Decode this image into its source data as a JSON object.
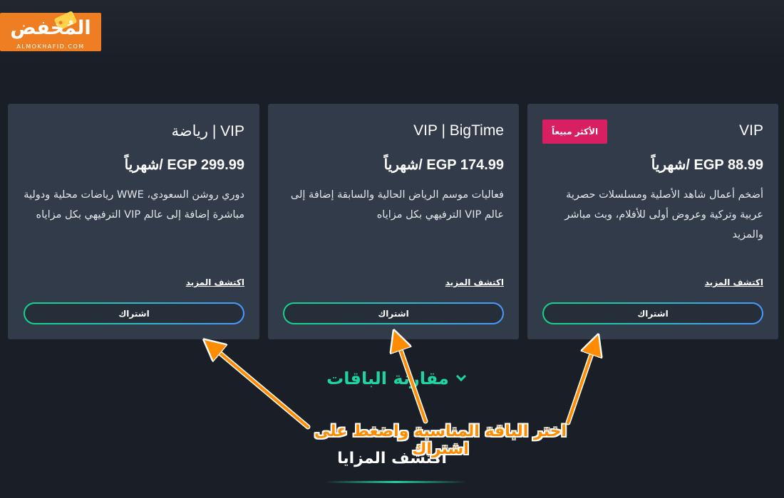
{
  "logo": {
    "text": "المُخفض",
    "subtext": "ALMOKHAFID.COM"
  },
  "plans": [
    {
      "title": "VIP",
      "badge": "الأكثر مبيعاً",
      "price": "EGP 88.99 /شهرياً",
      "description": "أضخم أعمال شاهد الأصلية ومسلسلات حصرية عربية وتركية وعروض أولى للأفلام، وبث مباشر والمزيد",
      "discover_label": "اكتشف المزيد",
      "subscribe_label": "اشتراك"
    },
    {
      "title": "VIP | BigTime",
      "price": "EGP 174.99 /شهرياً",
      "description": "فعاليات موسم الرياض الحالية والسابقة إضافة إلى عالم VIP الترفيهي بكل مزاياه",
      "discover_label": "اكتشف المزيد",
      "subscribe_label": "اشتراك"
    },
    {
      "title": "VIP | رياضة",
      "price": "EGP 299.99 /شهرياً",
      "description": "دوري روشن السعودي، WWE رياضات محلية ودولية مباشرة إضافة إلى عالم VIP الترفيهي بكل مزاياه",
      "discover_label": "اكتشف المزيد",
      "subscribe_label": "اشتراك"
    }
  ],
  "compare": {
    "label": "مقارنة الباقات",
    "icon": "chevron-down-icon"
  },
  "discover_features": {
    "label": "اكتشف المزايا"
  },
  "annotation": {
    "text": "اختر الباقة المناسبة واضغط على اشتراك",
    "color": "#ff8c00"
  },
  "colors": {
    "background": "#1a1f27",
    "card": "#323b4a",
    "badge": "#d81f61",
    "accent_green": "#1ed4a1",
    "accent_blue": "#4a97ff",
    "logo": "#ef7d22"
  }
}
